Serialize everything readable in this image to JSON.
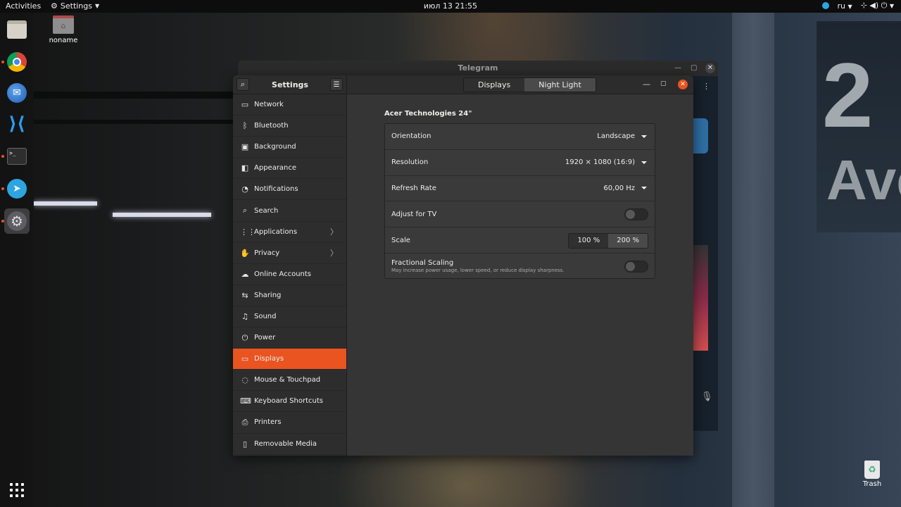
{
  "topbar": {
    "activities": "Activities",
    "app_menu": "Settings",
    "clock": "июл 13  21:55",
    "lang": "ru"
  },
  "dock": {
    "items": [
      "files-icon",
      "chrome-icon",
      "thunderbird-icon",
      "vscode-icon",
      "terminal-icon",
      "telegram-icon",
      "settings-icon"
    ]
  },
  "desktop": {
    "folder_label": "noname",
    "trash_label": "Trash"
  },
  "wallpaper": {
    "sign_number": "2",
    "sign_text": "Ave"
  },
  "telegram_window": {
    "title": "Telegram"
  },
  "settings": {
    "title": "Settings",
    "tabs": [
      {
        "label": "Displays",
        "active": false
      },
      {
        "label": "Night Light",
        "active": true
      }
    ],
    "sidebar": [
      {
        "label": "Network",
        "icon": "▭",
        "chevron": false
      },
      {
        "label": "Bluetooth",
        "icon": "ᛒ",
        "chevron": false
      },
      {
        "label": "Background",
        "icon": "▣",
        "chevron": false
      },
      {
        "label": "Appearance",
        "icon": "◧",
        "chevron": false
      },
      {
        "label": "Notifications",
        "icon": "◔",
        "chevron": false
      },
      {
        "label": "Search",
        "icon": "⌕",
        "chevron": false
      },
      {
        "label": "Applications",
        "icon": "⋮⋮",
        "chevron": true
      },
      {
        "label": "Privacy",
        "icon": "✋",
        "chevron": true
      },
      {
        "label": "Online Accounts",
        "icon": "☁",
        "chevron": false
      },
      {
        "label": "Sharing",
        "icon": "⇆",
        "chevron": false
      },
      {
        "label": "Sound",
        "icon": "♫",
        "chevron": false
      },
      {
        "label": "Power",
        "icon": "⏻",
        "chevron": false
      },
      {
        "label": "Displays",
        "icon": "▭",
        "chevron": false,
        "active": true
      },
      {
        "label": "Mouse & Touchpad",
        "icon": "◌",
        "chevron": false
      },
      {
        "label": "Keyboard Shortcuts",
        "icon": "⌨",
        "chevron": false
      },
      {
        "label": "Printers",
        "icon": "⎙",
        "chevron": false
      },
      {
        "label": "Removable Media",
        "icon": "▯",
        "chevron": false
      }
    ],
    "monitor_name": "Acer Technologies 24\"",
    "rows": {
      "orientation": {
        "label": "Orientation",
        "value": "Landscape"
      },
      "resolution": {
        "label": "Resolution",
        "value": "1920 × 1080 (16:9)"
      },
      "refresh": {
        "label": "Refresh Rate",
        "value": "60,00 Hz"
      },
      "adjust_tv": {
        "label": "Adjust for TV",
        "enabled": false
      },
      "scale": {
        "label": "Scale",
        "options": [
          "100 %",
          "200 %"
        ],
        "selected": "200 %"
      },
      "fractional": {
        "label": "Fractional Scaling",
        "sublabel": "May increase power usage, lower speed, or reduce display sharpness.",
        "enabled": false
      }
    }
  },
  "colors": {
    "accent": "#e95420",
    "panel_bg": "#353535",
    "topbar_bg": "#0d0d0d"
  }
}
